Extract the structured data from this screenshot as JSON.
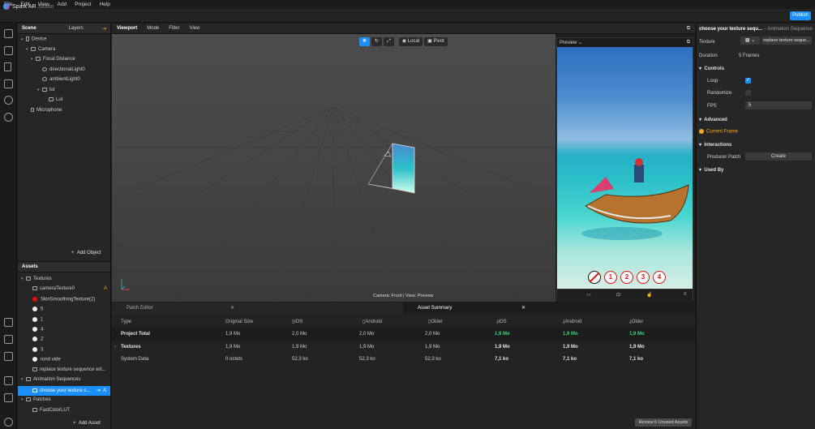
{
  "menu": [
    "File",
    "Edit",
    "View",
    "Add",
    "Project",
    "Help"
  ],
  "app": {
    "name": "Spark AR",
    "suffix": " Studio",
    "publish": "Publish"
  },
  "scene": {
    "tabs": [
      "Scene",
      "Layers"
    ],
    "items": [
      {
        "label": "Device",
        "icon": "device-icon"
      },
      {
        "label": "Camera",
        "icon": "camera-icon"
      },
      {
        "label": "Focal Distance",
        "icon": "focal-distance-icon"
      },
      {
        "label": "directionalLight0",
        "icon": "light-icon"
      },
      {
        "label": "ambientLight0",
        "icon": "ambient-light-icon"
      },
      {
        "label": "lut",
        "icon": "rectangle-icon"
      },
      {
        "label": "Lut",
        "icon": "rectangle-icon"
      },
      {
        "label": "Microphone",
        "icon": "microphone-icon"
      }
    ],
    "add_object": "Add Object"
  },
  "assets": {
    "title": "Assets",
    "items": [
      {
        "label": "Textures",
        "type": "folder"
      },
      {
        "label": "cameraTexture0",
        "badge": "A"
      },
      {
        "label": "SkinSmoothingTexture(2)"
      },
      {
        "label": "5"
      },
      {
        "label": "1"
      },
      {
        "label": "4"
      },
      {
        "label": "2"
      },
      {
        "label": "3"
      },
      {
        "label": "rond vide"
      },
      {
        "label": "replace texture sequence wit..."
      },
      {
        "label": "Animation Sequences",
        "type": "folder"
      },
      {
        "label": "choose your texture s...",
        "badge": "A"
      },
      {
        "label": "Patches",
        "type": "folder"
      },
      {
        "label": "FastColorLUT"
      }
    ],
    "add_asset": "Add Asset"
  },
  "viewport": {
    "tabs": [
      "Viewport",
      "Mode",
      "Filter",
      "View"
    ],
    "local": "Local",
    "pivot": "Pivot",
    "status": "Camera: Front | View: Preview"
  },
  "preview": {
    "label": "Preview",
    "numbers": [
      "1",
      "2",
      "3",
      "4"
    ]
  },
  "bottom": {
    "tabs": [
      "Patch Editor",
      "Asset Summary"
    ],
    "columns": [
      "Type",
      "Original Size",
      "iOS",
      "Android",
      "Older Android",
      "iOS",
      "Android",
      "Older Android"
    ],
    "rows": [
      {
        "type": "Project Total",
        "orig": "1,9 Mo",
        "ios": "2,0 Mo",
        "android": "2,0 Mo",
        "older": "2,0 Mo",
        "ios2": "1,9 Mo",
        "android2": "1,9 Mo",
        "older2": "1,9 Mo"
      },
      {
        "type": "Textures",
        "orig": "1,9 Mo",
        "ios": "1,9 Mo",
        "android": "1,9 Mo",
        "older": "1,9 Mo",
        "ios2": "1,9 Mo",
        "android2": "1,9 Mo",
        "older2": "1,9 Mo"
      },
      {
        "type": "System Data",
        "orig": "0 octets",
        "ios": "52,3 ko",
        "android": "52,3 ko",
        "older": "52,3 ko",
        "ios2": "7,1 ko",
        "android2": "7,1 ko",
        "older2": "7,1 ko"
      }
    ],
    "review": "Review 6 Unused Assets"
  },
  "inspector": {
    "title": "choose your texture sequ...",
    "subtitle": "– Animation Sequence",
    "texture_label": "Texture",
    "texture_value": "replace texture seque...",
    "duration_label": "Duration",
    "duration_value": "5 Frames",
    "controls": "Controls",
    "loop": "Loop",
    "randomize": "Randomize",
    "fps": "FPS",
    "fps_value": "5",
    "advanced": "Advanced",
    "current_frame": "Current Frame",
    "interactions": "Interactions",
    "producer_patch": "Producer Patch",
    "create": "Create",
    "used_by": "Used By"
  },
  "colors": {
    "accent": "#1a8fff",
    "green": "#37d67a",
    "badge": "#f5a623"
  }
}
